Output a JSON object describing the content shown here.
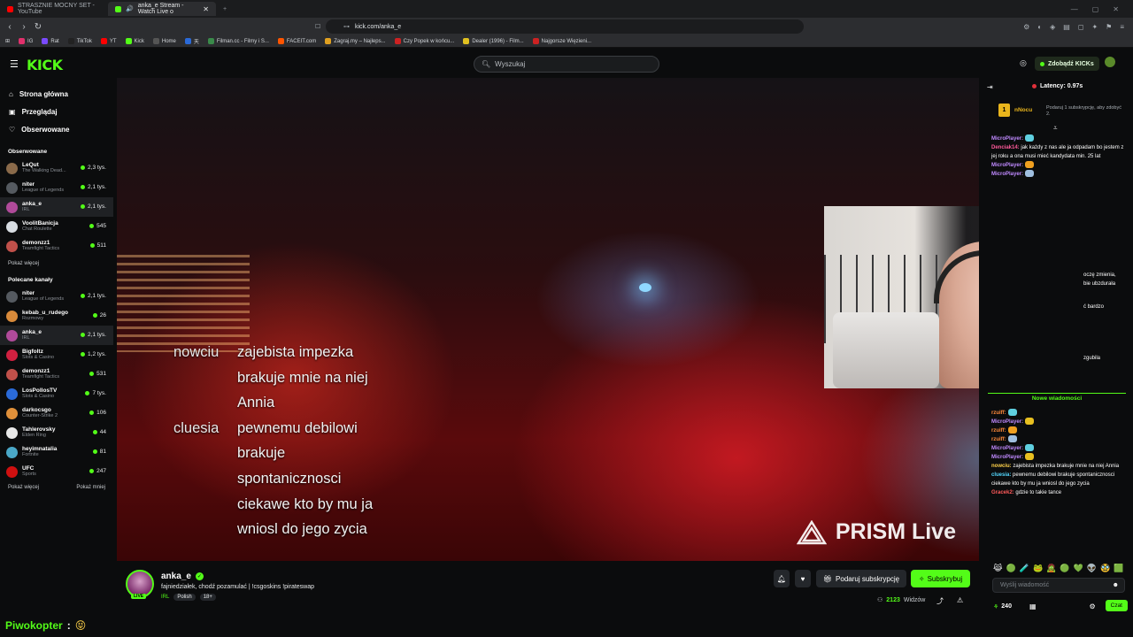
{
  "browser": {
    "tabs": [
      {
        "title": "STRASZNIE MOCNY SET - YouTube",
        "favicon_color": "#ff0000",
        "active": false
      },
      {
        "title": "anka_e Stream - Watch Live o",
        "favicon_color": "#53fc18",
        "active": true
      }
    ],
    "url": "kick.com/anka_e",
    "bookmarks": [
      "IG",
      "Rat",
      "TikTok",
      "YT",
      "Kick",
      "Home",
      "天",
      "Filman.cc - Filmy i S...",
      "FACEIT.com",
      "Zagraj.my – Najleps...",
      "Czy Popek w końcu...",
      "Dealer (1996) - Film...",
      "Najgorsze Więzieni..."
    ]
  },
  "header": {
    "logo": "KICK",
    "search_placeholder": "Wyszukaj",
    "get_kicks": "Zdobądź KICKs"
  },
  "sidebar": {
    "nav": [
      {
        "label": "Strona główna",
        "icon": "home-icon"
      },
      {
        "label": "Przeglądaj",
        "icon": "browse-icon"
      },
      {
        "label": "Obserwowane",
        "icon": "heart-icon"
      }
    ],
    "followed_title": "Obserwowane",
    "followed": [
      {
        "name": "LeQut",
        "category": "The Walking Dead...",
        "viewers": "2,3 tys.",
        "color": "#8a6a4a"
      },
      {
        "name": "niter",
        "category": "League of Legends",
        "viewers": "2,1 tys.",
        "color": "#555a60"
      },
      {
        "name": "anka_e",
        "category": "IRL",
        "viewers": "2,1 tys.",
        "color": "#b04a9a",
        "selected": true
      },
      {
        "name": "VoolitBanicja",
        "category": "Chat Roulette",
        "viewers": "545",
        "color": "#d8dde2"
      },
      {
        "name": "demonzz1",
        "category": "Teamfight Tactics",
        "viewers": "511",
        "color": "#c0504a"
      }
    ],
    "show_more": "Pokaż więcej",
    "recommended_title": "Polecane kanały",
    "recommended": [
      {
        "name": "niter",
        "category": "League of Legends",
        "viewers": "2,1 tys.",
        "color": "#555a60"
      },
      {
        "name": "kebab_u_rudego",
        "category": "Rozmowy",
        "viewers": "26",
        "color": "#d88a3a"
      },
      {
        "name": "anka_e",
        "category": "IRL",
        "viewers": "2,1 tys.",
        "color": "#b04a9a",
        "selected": true
      },
      {
        "name": "Bigfoltz",
        "category": "Slots & Casino",
        "viewers": "1,2 tys.",
        "color": "#d02040"
      },
      {
        "name": "demonzz1",
        "category": "Teamfight Tactics",
        "viewers": "531",
        "color": "#c0504a"
      },
      {
        "name": "LosPollosTV",
        "category": "Slots & Casino",
        "viewers": "7 tys.",
        "color": "#2a6ad8"
      },
      {
        "name": "darkocsgo",
        "category": "Counter-Strike 2",
        "viewers": "106",
        "color": "#e0903a"
      },
      {
        "name": "Tahlerovsky",
        "category": "Elden Ring",
        "viewers": "44",
        "color": "#e8e8e8"
      },
      {
        "name": "heyimnatalia",
        "category": "Fortnite",
        "viewers": "81",
        "color": "#4aa8c8"
      },
      {
        "name": "UFC",
        "category": "Sports",
        "viewers": "247",
        "color": "#d01010"
      }
    ],
    "show_more2": "Pokaż więcej",
    "show_less": "Pokaż mniej"
  },
  "video": {
    "overlay_chat": [
      {
        "user": "nowciu",
        "lines": [
          "zajebista impezka",
          "brakuje mnie na niej",
          "Annia"
        ]
      },
      {
        "user": "cluesia",
        "lines": [
          "pewnemu debilowi",
          "brakuje",
          "spontanicznosci",
          "ciekawe kto by mu ja",
          "wniosl do jego zycia"
        ]
      }
    ],
    "watermark": "PRISM Live"
  },
  "stream": {
    "streamer": "anka_e",
    "live_badge": "LIVE",
    "title": "fajniedziałek, chodź pozamulać | !csgoskins !pirateswap",
    "category": "IRL",
    "tags": [
      "Polish",
      "18+"
    ],
    "gift_sub": "Podaruj subskrypcję",
    "subscribe": "Subskrybuj",
    "viewers": "2123",
    "viewers_label": "Widzów"
  },
  "chat": {
    "latency": "Latency: 0.97s",
    "pinned_user": "nNocu",
    "pinned_medal": "1",
    "pinned_text": "Podaruj 1 subskrypcję, aby zdobyć 2.",
    "messages": [
      {
        "user": "MicroPlayer:",
        "color": "#c08aff",
        "text": ""
      },
      {
        "user": "Denciak14:",
        "color": "#ff5a9a",
        "text": "jak każdy z nas ale ja odpadam bo jestem z jej roku a ona musi mieć kandydata min. 25 lat"
      },
      {
        "user": "MicroPlayer:",
        "color": "#c08aff",
        "text": ""
      },
      {
        "user": "MicroPlayer:",
        "color": "#c08aff",
        "text": ""
      }
    ],
    "partial_texts": [
      "oczę zmienia,",
      "bie ubzdurała",
      "ć bardzo",
      "zgubila"
    ],
    "new_messages": "Nowe wiadomości",
    "messages2": [
      {
        "user": "rzuiff:",
        "color": "#ff8a3a",
        "text": ""
      },
      {
        "user": "MicroPlayer:",
        "color": "#c08aff",
        "text": ""
      },
      {
        "user": "rzuiff:",
        "color": "#ff8a3a",
        "text": ""
      },
      {
        "user": "rzuiff:",
        "color": "#ff8a3a",
        "text": ""
      },
      {
        "user": "MicroPlayer:",
        "color": "#c08aff",
        "text": ""
      },
      {
        "user": "MicroPlayer:",
        "color": "#c08aff",
        "text": ""
      },
      {
        "user": "nowciu:",
        "color": "#ffd24a",
        "text": "zajebista impezka brakuje mnie na niej Annia"
      },
      {
        "user": "cluesia:",
        "color": "#53d8ff",
        "text": "pewnemu debilowi brakuje spontanicznosci ciekawe kto by mu ja wniosl do jego zycia"
      },
      {
        "user": "Gracek2:",
        "color": "#ff5a5a",
        "text": "gdzie to takie tance"
      }
    ],
    "input_placeholder": "Wyślij wiadomość",
    "kicks": "240",
    "send": "Czat"
  },
  "footer": {
    "user": "Piwokopter",
    "sep": ":",
    "emoji": "😝"
  }
}
